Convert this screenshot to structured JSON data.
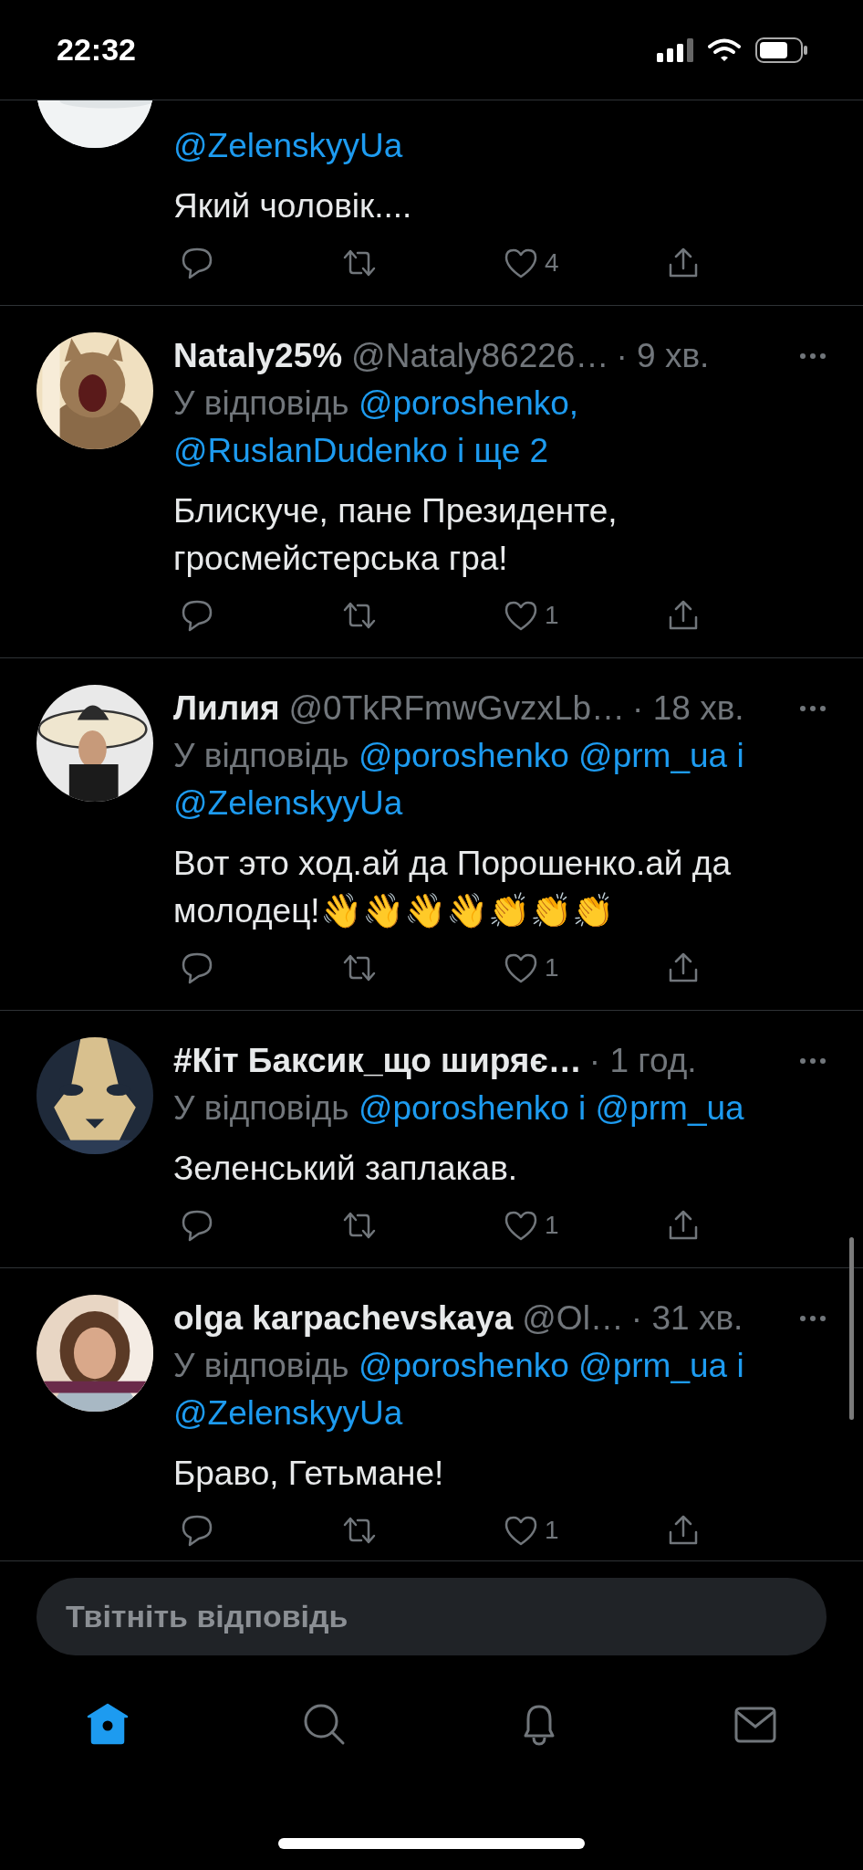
{
  "status_bar": {
    "time": "22:32"
  },
  "tweets": [
    {
      "mentions": "@ZelenskyyUa",
      "text": "Який чоловік....",
      "like_count": "4"
    },
    {
      "name": "Nataly25%",
      "handle": "@Nataly86226…",
      "time": "· 9 хв.",
      "reply_prefix": "У відповідь",
      "mentions": "@poroshenko, @RuslanDudenko і ще 2",
      "text": "Блискуче, пане Президенте, гросмейстерська гра!",
      "like_count": "1"
    },
    {
      "name": "Лилия",
      "handle": "@0TkRFmwGvzxLb…",
      "time": "· 18 хв.",
      "reply_prefix": "У відповідь",
      "mentions": "@poroshenko @prm_ua і @ZelenskyyUa",
      "text": "Вот это ход.ай да Порошенко.ай да молодец!👋👋👋👋👏👏👏",
      "like_count": "1"
    },
    {
      "name": "#Кіт Баксик_що ширяє…",
      "time": "· 1 год.",
      "reply_prefix": "У відповідь",
      "mentions": "@poroshenko і @prm_ua",
      "text": "Зеленський заплакав.",
      "like_count": "1"
    },
    {
      "name": "olga karpachevskaya",
      "handle": "@Ol…",
      "time": "· 31 хв.",
      "reply_prefix": "У відповідь",
      "mentions": "@poroshenko @prm_ua і @ZelenskyyUa",
      "text": "Браво, Гетьмане!",
      "like_count": "1"
    }
  ],
  "reply_field": {
    "placeholder": "Твітніть відповідь"
  },
  "tab_bar": [
    {
      "kind": "home",
      "selected": true
    },
    {
      "kind": "search",
      "selected": false
    },
    {
      "kind": "notifications",
      "selected": false
    },
    {
      "kind": "messages",
      "selected": false
    }
  ]
}
